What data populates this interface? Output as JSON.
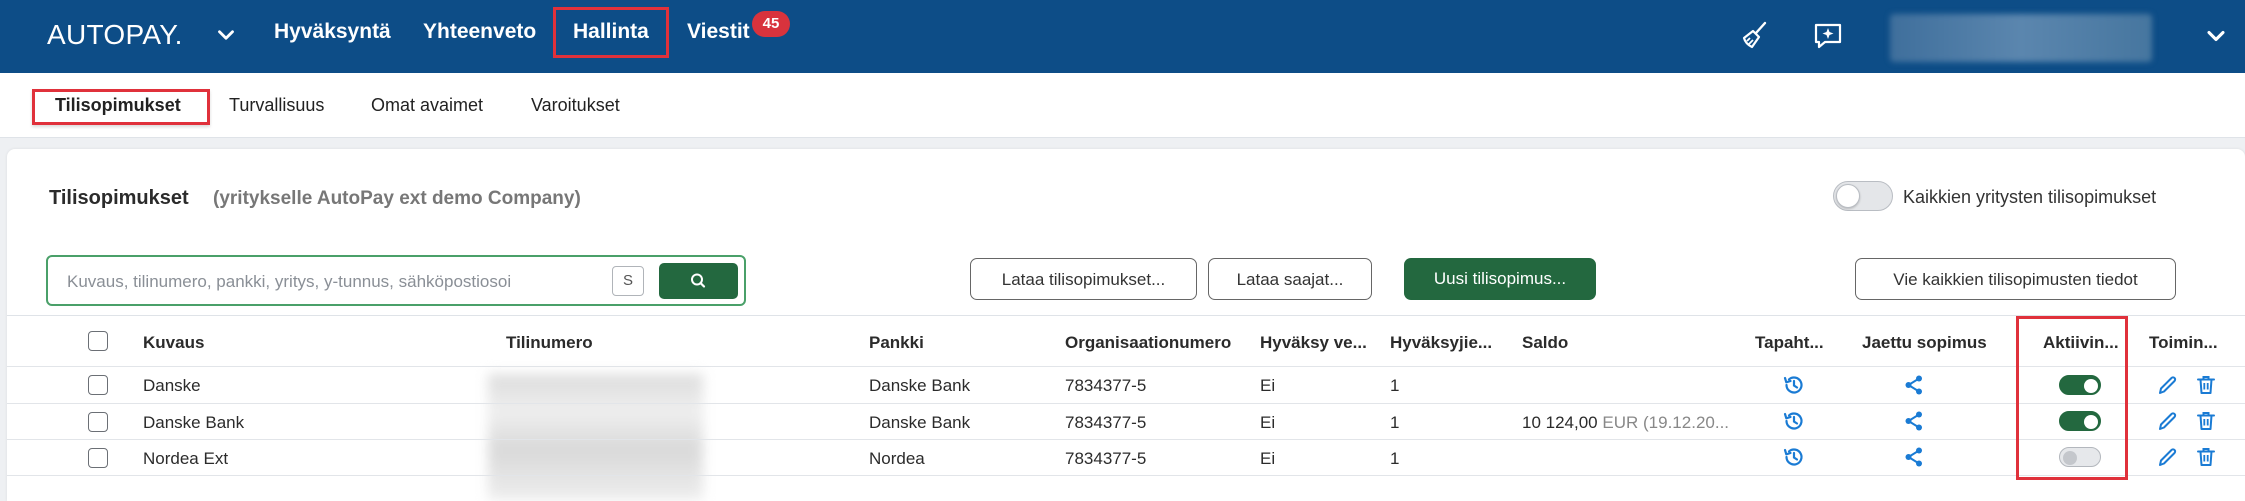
{
  "app": {
    "logo": "AUTOPAY.",
    "nav": [
      {
        "label": "Hyväksyntä"
      },
      {
        "label": "Yhteenveto"
      },
      {
        "label": "Hallinta"
      },
      {
        "label": "Viestit"
      }
    ],
    "messages_badge": "45",
    "colors": {
      "header": "#0d4d87",
      "accent_green": "#23683f",
      "highlight_red": "#e0313b"
    }
  },
  "subnav": [
    {
      "label": "Tilisopimukset"
    },
    {
      "label": "Turvallisuus"
    },
    {
      "label": "Omat avaimet"
    },
    {
      "label": "Varoitukset"
    }
  ],
  "page": {
    "title": "Tilisopimukset",
    "subtitle": "(yritykselle AutoPay ext demo Company)",
    "all_companies_toggle_label": "Kaikkien yritysten tilisopimukset",
    "all_companies_toggle_on": false
  },
  "search": {
    "placeholder": "Kuvaus, tilinumero, pankki, yritys, y-tunnus, sähköpostiosoi",
    "shortcut": "S"
  },
  "buttons": {
    "load_contracts": "Lataa tilisopimukset...",
    "load_payees": "Lataa saajat...",
    "new_contract": "Uusi tilisopimus...",
    "export_all": "Vie kaikkien tilisopimusten tiedot"
  },
  "table": {
    "columns": [
      "Kuvaus",
      "Tilinumero",
      "Pankki",
      "Organisaationumero",
      "Hyväksy ve...",
      "Hyväksyjie...",
      "Saldo",
      "Tapaht...",
      "Jaettu sopimus",
      "Aktiivin...",
      "Toimin..."
    ],
    "rows": [
      {
        "kuvaus": "Danske",
        "pankki": "Danske Bank",
        "org": "7834377-5",
        "hyvaksy": "Ei",
        "hyvaksyjia": "1",
        "saldo_amount": "",
        "saldo_currency": "",
        "saldo_date": "",
        "active": true
      },
      {
        "kuvaus": "Danske Bank",
        "pankki": "Danske Bank",
        "org": "7834377-5",
        "hyvaksy": "Ei",
        "hyvaksyjia": "1",
        "saldo_amount": "10 124,00",
        "saldo_currency": "EUR",
        "saldo_date": "(19.12.20...",
        "active": true
      },
      {
        "kuvaus": "Nordea Ext",
        "pankki": "Nordea",
        "org": "7834377-5",
        "hyvaksy": "Ei",
        "hyvaksyjia": "1",
        "saldo_amount": "",
        "saldo_currency": "",
        "saldo_date": "",
        "active": false
      }
    ]
  }
}
